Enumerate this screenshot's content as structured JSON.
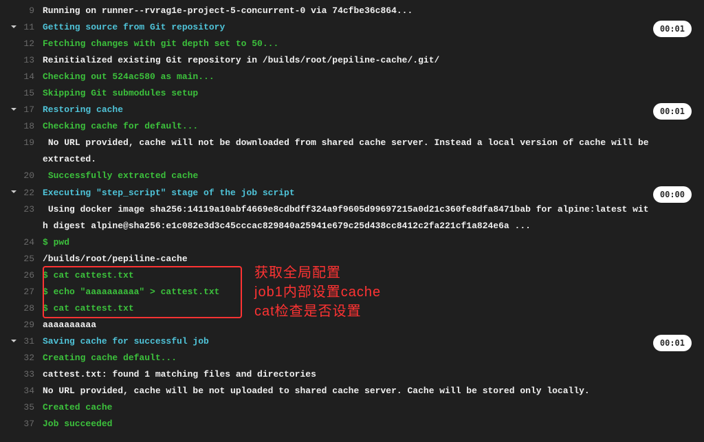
{
  "lines": [
    {
      "no": 9,
      "chevron": false,
      "cls": "c-white",
      "text": "Running on runner--rvrag1e-project-5-concurrent-0 via 74cfbe36c864...",
      "timer": null,
      "timerPartial": ""
    },
    {
      "no": 11,
      "chevron": true,
      "cls": "c-cyan",
      "text": "Getting source from Git repository",
      "timer": "00:01"
    },
    {
      "no": 12,
      "chevron": false,
      "cls": "c-green",
      "text": "Fetching changes with git depth set to 50..."
    },
    {
      "no": 13,
      "chevron": false,
      "cls": "c-white",
      "text": "Reinitialized existing Git repository in /builds/root/pepiline-cache/.git/"
    },
    {
      "no": 14,
      "chevron": false,
      "cls": "c-green",
      "text": "Checking out 524ac580 as main..."
    },
    {
      "no": 15,
      "chevron": false,
      "cls": "c-green",
      "text": "Skipping Git submodules setup"
    },
    {
      "no": 17,
      "chevron": true,
      "cls": "c-cyan",
      "text": "Restoring cache",
      "timer": "00:01"
    },
    {
      "no": 18,
      "chevron": false,
      "cls": "c-green",
      "text": "Checking cache for default..."
    },
    {
      "no": 19,
      "chevron": false,
      "cls": "c-white",
      "text": " No URL provided, cache will not be downloaded from shared cache server. Instead a local version of cache will be extracted."
    },
    {
      "no": 20,
      "chevron": false,
      "cls": "c-green",
      "text": " Successfully extracted cache"
    },
    {
      "no": 22,
      "chevron": true,
      "cls": "c-cyan",
      "text": "Executing \"step_script\" stage of the job script",
      "timer": "00:00"
    },
    {
      "no": 23,
      "chevron": false,
      "cls": "c-white",
      "text": " Using docker image sha256:14119a10abf4669e8cdbdff324a9f9605d99697215a0d21c360fe8dfa8471bab for alpine:latest with digest alpine@sha256:e1c082e3d3c45cccac829840a25941e679c25d438cc8412c2fa221cf1a824e6a ..."
    },
    {
      "no": 24,
      "chevron": false,
      "cls": "c-lime",
      "text": "$ pwd"
    },
    {
      "no": 25,
      "chevron": false,
      "cls": "c-white",
      "text": "/builds/root/pepiline-cache"
    },
    {
      "no": 26,
      "chevron": false,
      "cls": "c-lime",
      "text": "$ cat cattest.txt"
    },
    {
      "no": 27,
      "chevron": false,
      "cls": "c-lime",
      "text": "$ echo \"aaaaaaaaaa\" > cattest.txt"
    },
    {
      "no": 28,
      "chevron": false,
      "cls": "c-lime",
      "text": "$ cat cattest.txt"
    },
    {
      "no": 29,
      "chevron": false,
      "cls": "c-white",
      "text": "aaaaaaaaaa"
    },
    {
      "no": 31,
      "chevron": true,
      "cls": "c-cyan",
      "text": "Saving cache for successful job",
      "timer": "00:01"
    },
    {
      "no": 32,
      "chevron": false,
      "cls": "c-green",
      "text": "Creating cache default..."
    },
    {
      "no": 33,
      "chevron": false,
      "cls": "c-white",
      "text": "cattest.txt: found 1 matching files and directories "
    },
    {
      "no": 34,
      "chevron": false,
      "cls": "c-white",
      "text": "No URL provided, cache will be not uploaded to shared cache server. Cache will be stored only locally."
    },
    {
      "no": 35,
      "chevron": false,
      "cls": "c-green",
      "text": "Created cache"
    },
    {
      "no": 37,
      "chevron": false,
      "cls": "c-green",
      "text": "Job succeeded"
    }
  ],
  "annotations": {
    "line1": "获取全局配置",
    "line2": "job1内部设置cache",
    "line3": "cat检查是否设置"
  },
  "redbox": {
    "top_line": 26,
    "bottom_line": 28
  }
}
